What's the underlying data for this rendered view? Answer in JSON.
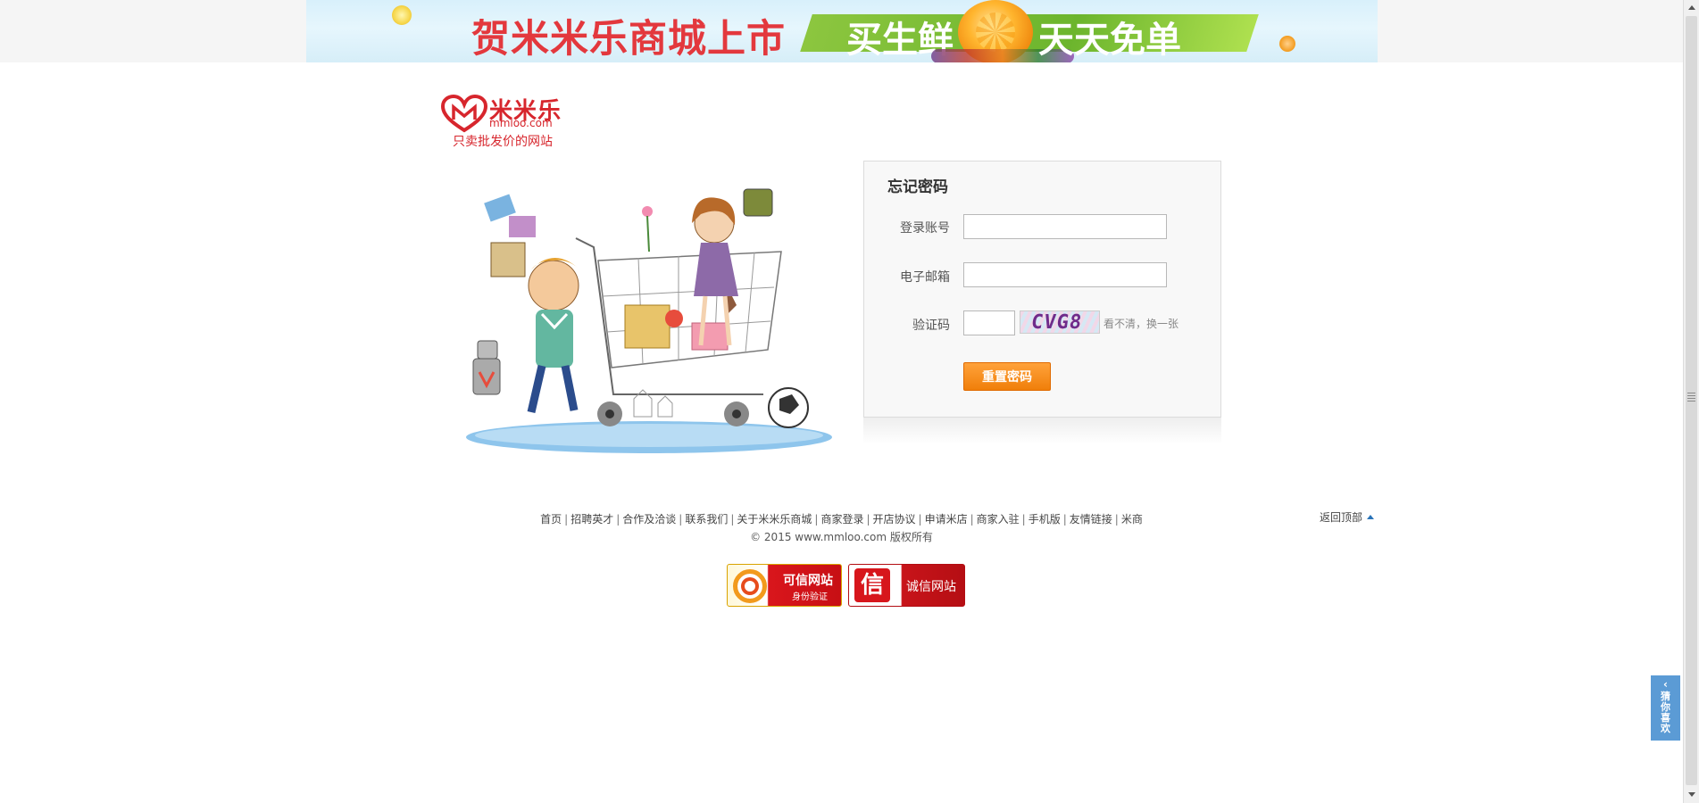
{
  "banner": {
    "title": "贺米米乐商城上市",
    "slogan_left": "买生鲜",
    "slogan_right": "天天免单"
  },
  "logo": {
    "brand": "米米乐",
    "domain": "mmloo.com",
    "slogan": "只卖批发价的网站"
  },
  "form": {
    "title": "忘记密码",
    "account_label": "登录账号",
    "account_value": "",
    "email_label": "电子邮箱",
    "email_value": "",
    "code_label": "验证码",
    "code_value": "",
    "captcha_text": "CVG8",
    "refresh_label": "看不清，换一张",
    "submit_label": "重置密码"
  },
  "footer": {
    "links": [
      "首页",
      "招聘英才",
      "合作及洽谈",
      "联系我们",
      "关于米米乐商城",
      "商家登录",
      "开店协议",
      "申请米店",
      "商家入驻",
      "手机版",
      "友情链接",
      "米商"
    ],
    "separator": "|",
    "copyright": "© 2015 www.mmloo.com 版权所有",
    "back_to_top": "返回顶部",
    "badge1_title": "可信网站",
    "badge1_sub": "身份验证",
    "badge2_icon": "信",
    "badge2_title": "诚信网站"
  },
  "side_tab": {
    "chevron": "‹",
    "label": "猜你喜欢"
  },
  "icons": {
    "logo": "heart-m-icon",
    "back_top": "caret-up-icon",
    "side_tab": "chevron-left-icon",
    "badge1": "shield-ring-icon",
    "badge2": "xin-seal-icon"
  },
  "colors": {
    "brand_red": "#d7262d",
    "button_orange": "#f07f0a",
    "side_tab_blue": "#5b9bd5",
    "banner_green": "#8cc63f"
  }
}
